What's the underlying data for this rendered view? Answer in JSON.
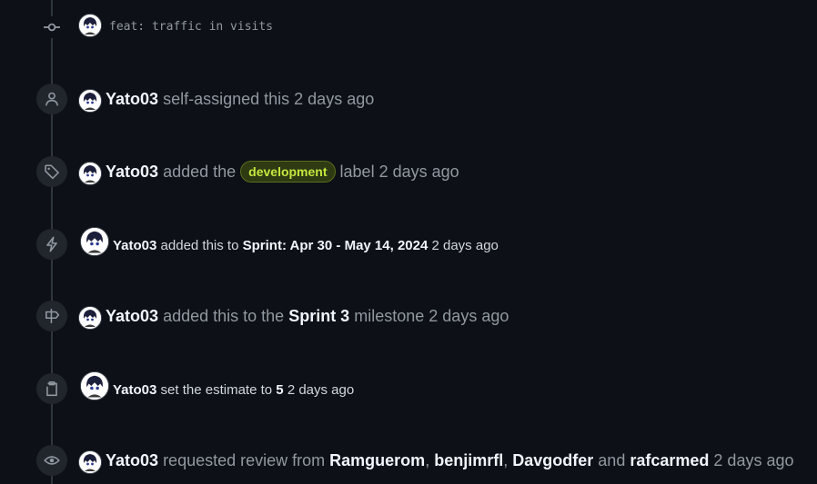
{
  "commit": {
    "message": "feat: traffic in visits"
  },
  "events": {
    "assign": {
      "author": "Yato03",
      "action": "self-assigned this",
      "time": "2 days ago"
    },
    "label": {
      "author": "Yato03",
      "prefix": "added the",
      "label_name": "development",
      "label_color": "#c5e63f",
      "suffix": "label",
      "time": "2 days ago"
    },
    "sprint": {
      "author": "Yato03",
      "prefix": "added this to",
      "sprint_name": "Sprint: Apr 30 - May 14, 2024",
      "time": "2 days ago"
    },
    "milestone": {
      "author": "Yato03",
      "prefix": "added this to the",
      "milestone_name": "Sprint 3",
      "suffix": "milestone",
      "time": "2 days ago"
    },
    "estimate": {
      "author": "Yato03",
      "prefix": "set the estimate to",
      "value": "5",
      "time": "2 days ago"
    },
    "review": {
      "author": "Yato03",
      "prefix": "requested review from",
      "reviewer1": "Ramguerom",
      "sep1": ",",
      "reviewer2": "benjimrfl",
      "sep2": ",",
      "reviewer3": "Davgodfer",
      "conj": "and",
      "reviewer4": "rafcarmed",
      "time": "2 days ago"
    }
  },
  "icons": {
    "commit": "git-commit-icon",
    "assign": "person-icon",
    "label": "tag-icon",
    "sprint": "lightning-icon",
    "milestone": "milestone-icon",
    "estimate": "clipboard-icon",
    "review": "eye-icon"
  },
  "colors": {
    "background": "#0d1117",
    "badge": "#21262d",
    "text_primary": "#f0f6fc",
    "text_muted": "#9198a1"
  }
}
